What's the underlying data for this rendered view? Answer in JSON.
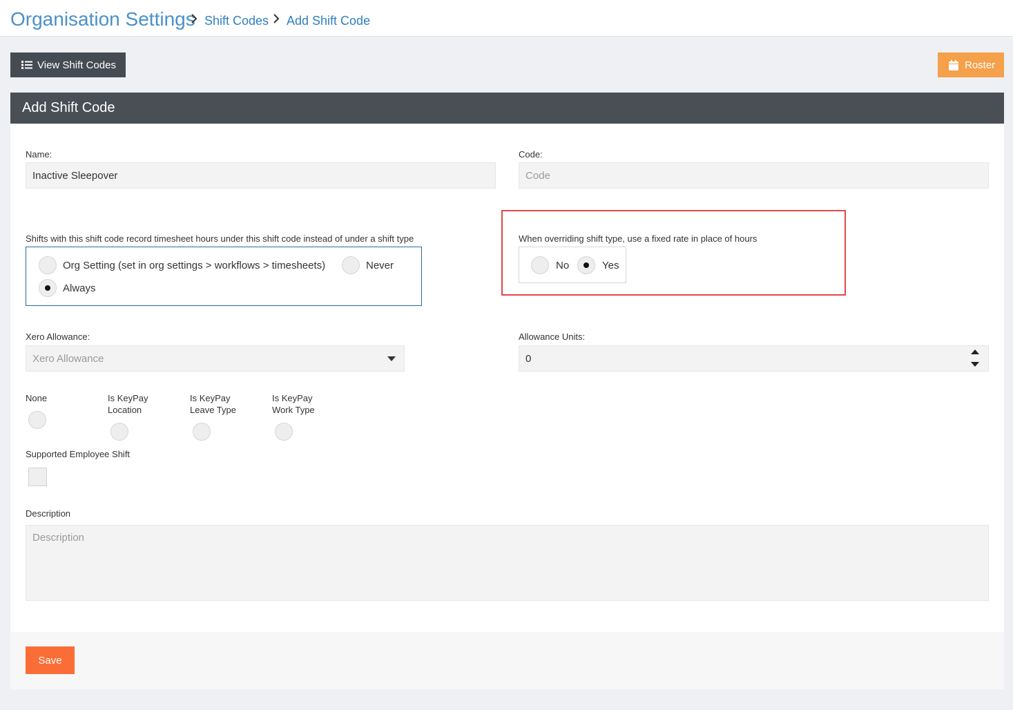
{
  "breadcrumb": {
    "title": "Organisation Settings",
    "items": [
      "Shift Codes",
      "Add Shift Code"
    ]
  },
  "toolbar": {
    "view_label": "View Shift Codes",
    "roster_label": "Roster"
  },
  "panel": {
    "title": "Add Shift Code"
  },
  "form": {
    "name_label": "Name:",
    "name_value": "Inactive Sleepover",
    "code_label": "Code:",
    "code_placeholder": "Code",
    "record_label": "Shifts with this shift code record timesheet hours under this shift code instead of under a shift type",
    "record_options": [
      "Org Setting (set in org settings > workflows > timesheets)",
      "Never",
      "Always"
    ],
    "record_selected": "Always",
    "fixed_rate_label": "When overriding shift type, use a fixed rate in place of hours",
    "fixed_rate_options": [
      "No",
      "Yes"
    ],
    "fixed_rate_selected": "Yes",
    "xero_label": "Xero Allowance:",
    "xero_placeholder": "Xero Allowance",
    "units_label": "Allowance Units:",
    "units_value": "0",
    "keypay_options": [
      {
        "line1": "None",
        "line2": ""
      },
      {
        "line1": "Is KeyPay",
        "line2": "Location"
      },
      {
        "line1": "Is KeyPay",
        "line2": "Leave Type"
      },
      {
        "line1": "Is KeyPay",
        "line2": "Work Type"
      }
    ],
    "supported_label": "Supported Employee Shift",
    "description_label": "Description",
    "description_placeholder": "Description"
  },
  "footer": {
    "save_label": "Save"
  },
  "colors": {
    "breadcrumb_title": "#4a90c8",
    "link": "#2f7fc1",
    "dark_button": "#454b53",
    "roster_button": "#f5a04a",
    "panel_header": "#4a4f56",
    "save_button": "#fb6d36",
    "highlight_border": "#e5454a",
    "focus_border": "#2d6b9a"
  },
  "icons": {
    "view": "list-icon",
    "roster": "calendar-icon",
    "separator": "chevron-right-icon"
  }
}
